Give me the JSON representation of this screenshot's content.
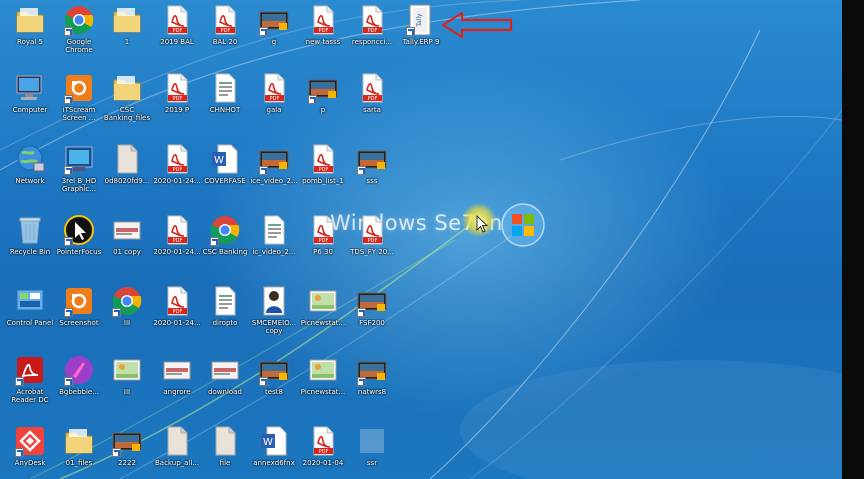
{
  "desktop": {
    "brand_text": "Windows Se7en",
    "icons": [
      {
        "label": "Royal 5",
        "type": "folder"
      },
      {
        "label": "Google Chrome",
        "type": "chrome"
      },
      {
        "label": "1",
        "type": "folder"
      },
      {
        "label": "2019 BAL",
        "type": "pdf"
      },
      {
        "label": "BAL 20",
        "type": "pdf"
      },
      {
        "label": "g",
        "type": "video"
      },
      {
        "label": "new tasss",
        "type": "pdf"
      },
      {
        "label": "responcci...",
        "type": "pdf"
      },
      {
        "label": "Tally.ERP 9",
        "type": "tally"
      },
      {
        "label": "Computer",
        "type": "computer"
      },
      {
        "label": "iTScream Screen ...",
        "type": "orange"
      },
      {
        "label": "CSC Banking_files",
        "type": "folder"
      },
      {
        "label": "2019 P",
        "type": "pdf"
      },
      {
        "label": "CHNHOT",
        "type": "doc"
      },
      {
        "label": "gala",
        "type": "pdf"
      },
      {
        "label": "p",
        "type": "video"
      },
      {
        "label": "sarta",
        "type": "pdf"
      },
      {
        "label": "Network",
        "type": "network"
      },
      {
        "label": "3rel B_HD Graphic...",
        "type": "graphics"
      },
      {
        "label": "0d8020fd9...",
        "type": "blank"
      },
      {
        "label": "2020-01-24...",
        "type": "pdf"
      },
      {
        "label": "COVERFASE",
        "type": "word"
      },
      {
        "label": "ice_video_2...",
        "type": "video"
      },
      {
        "label": "pomb_list_1",
        "type": "pdf"
      },
      {
        "label": "sss",
        "type": "video"
      },
      {
        "label": "Recycle Bin",
        "type": "recycle"
      },
      {
        "label": "PointerFocus",
        "type": "pointer"
      },
      {
        "label": "01 copy",
        "type": "thumb"
      },
      {
        "label": "2020-01-24...",
        "type": "pdf"
      },
      {
        "label": "CSC Banking",
        "type": "chrome"
      },
      {
        "label": "ic_video_2...",
        "type": "doc"
      },
      {
        "label": "P6 30",
        "type": "pdf"
      },
      {
        "label": "TDS_FY 20...",
        "type": "pdf"
      },
      {
        "label": "Control Panel",
        "type": "control"
      },
      {
        "label": "Screenshot",
        "type": "orange"
      },
      {
        "label": "III",
        "type": "chrome"
      },
      {
        "label": "2020-01-24...",
        "type": "pdf"
      },
      {
        "label": "diropto",
        "type": "doc"
      },
      {
        "label": "SMCEMEIO... copy",
        "type": "person"
      },
      {
        "label": "Picnewstat...",
        "type": "photo"
      },
      {
        "label": "FSF200",
        "type": "video"
      },
      {
        "label": "Acrobat Reader DC",
        "type": "acrobat"
      },
      {
        "label": "Bgbebble...",
        "type": "purple"
      },
      {
        "label": "III",
        "type": "photo"
      },
      {
        "label": "angrore",
        "type": "thumb"
      },
      {
        "label": "download",
        "type": "thumb"
      },
      {
        "label": "test8",
        "type": "video"
      },
      {
        "label": "Picnewstat...",
        "type": "photo"
      },
      {
        "label": "natwrs8",
        "type": "video"
      },
      {
        "label": "AnyDesk",
        "type": "anydesk"
      },
      {
        "label": "01_files",
        "type": "folder"
      },
      {
        "label": "2222",
        "type": "video"
      },
      {
        "label": "Backup_all...",
        "type": "blank"
      },
      {
        "label": "file",
        "type": "blank"
      },
      {
        "label": "annexd6fnx",
        "type": "word"
      },
      {
        "label": "2020-01-04",
        "type": "pdf"
      },
      {
        "label": "ssr",
        "type": "dim"
      }
    ]
  },
  "colors": {
    "pdf_red": "#d9261c",
    "folder": "#e9c55a",
    "annotation_arrow": "#e0201a"
  }
}
